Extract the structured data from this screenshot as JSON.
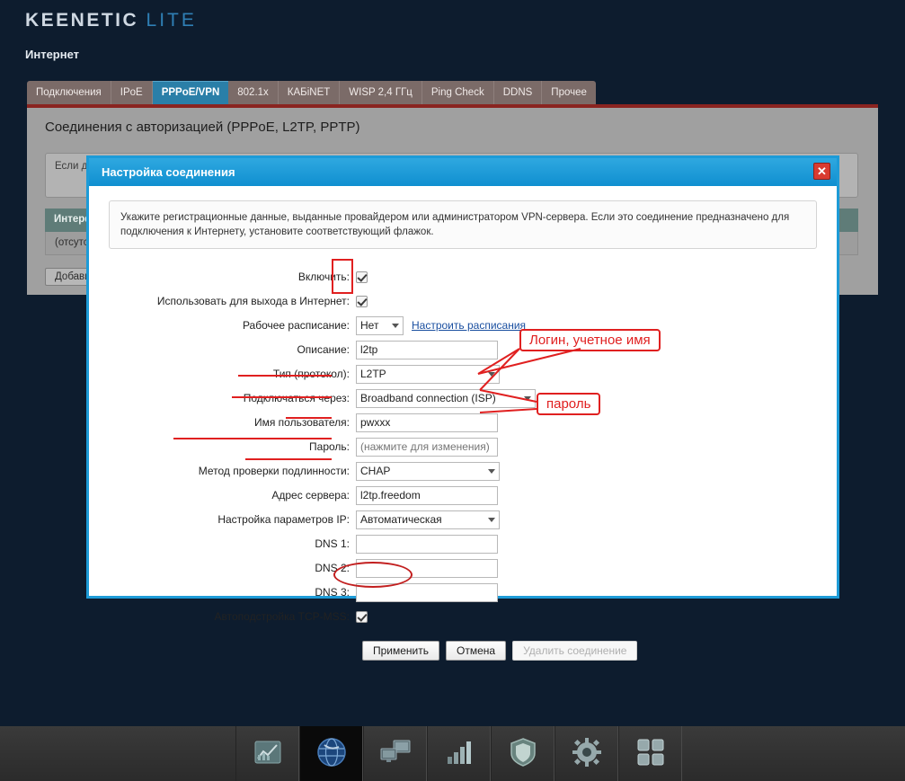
{
  "brand": {
    "name": "KEENETIC",
    "model": "LITE",
    "section": "Интернет"
  },
  "tabs": [
    {
      "label": "Подключения",
      "active": false
    },
    {
      "label": "IPoE",
      "active": false
    },
    {
      "label": "PPPoE/VPN",
      "active": true
    },
    {
      "label": "802.1x",
      "active": false
    },
    {
      "label": "КАБiNET",
      "active": false
    },
    {
      "label": "WISP 2,4 ГГц",
      "active": false
    },
    {
      "label": "Ping Check",
      "active": false
    },
    {
      "label": "DDNS",
      "active": false
    },
    {
      "label": "Прочее",
      "active": false
    }
  ],
  "page": {
    "title": "Соединения с авторизацией (PPPoE, L2TP, PPTP)",
    "note": "Если д…\nкорпор…",
    "grid_header": "Интерф…",
    "grid_empty": "(отсутст…",
    "add_button": "Добави…"
  },
  "dialog": {
    "title": "Настройка соединения",
    "close_label": "✕",
    "info": "Укажите регистрационные данные, выданные провайдером или администратором VPN-сервера. Если это соединение предназначено для подключения к Интернету, установите соответствующий флажок.",
    "fields": {
      "enable_label": "Включить:",
      "enable_checked": true,
      "use_internet_label": "Использовать для выхода в Интернет:",
      "use_internet_checked": true,
      "schedule_label": "Рабочее расписание:",
      "schedule_value": "Нет",
      "schedule_link": "Настроить расписания",
      "description_label": "Описание:",
      "description_value": "l2tp",
      "protocol_label": "Тип (протокол):",
      "protocol_value": "L2TP",
      "via_label": "Подключаться через:",
      "via_value": "Broadband connection (ISP)",
      "username_label": "Имя пользователя:",
      "username_value": "pwxxx",
      "password_label": "Пароль:",
      "password_placeholder": "(нажмите для изменения)",
      "auth_label": "Метод проверки подлинности:",
      "auth_value": "CHAP",
      "server_label": "Адрес сервера:",
      "server_value": "l2tp.freedom",
      "ipsetup_label": "Настройка параметров IP:",
      "ipsetup_value": "Автоматическая",
      "dns1_label": "DNS 1:",
      "dns1_value": "",
      "dns2_label": "DNS 2:",
      "dns2_value": "",
      "dns3_label": "DNS 3:",
      "dns3_value": "",
      "tcpmss_label": "Автоподстройка TCP-MSS:",
      "tcpmss_checked": true
    },
    "buttons": {
      "apply": "Применить",
      "cancel": "Отмена",
      "delete": "Удалить соединение"
    }
  },
  "annotations": {
    "login_callout": "Логин, учетное имя",
    "password_callout": "пароль",
    "color": "#e02020"
  },
  "taskbar": {
    "items": [
      {
        "icon": "monitor-chart-icon",
        "active": false
      },
      {
        "icon": "globe-icon",
        "active": true
      },
      {
        "icon": "network-computers-icon",
        "active": false
      },
      {
        "icon": "signal-bars-icon",
        "active": false
      },
      {
        "icon": "shield-icon",
        "active": false
      },
      {
        "icon": "gear-icon",
        "active": false
      },
      {
        "icon": "apps-grid-icon",
        "active": false
      }
    ]
  }
}
